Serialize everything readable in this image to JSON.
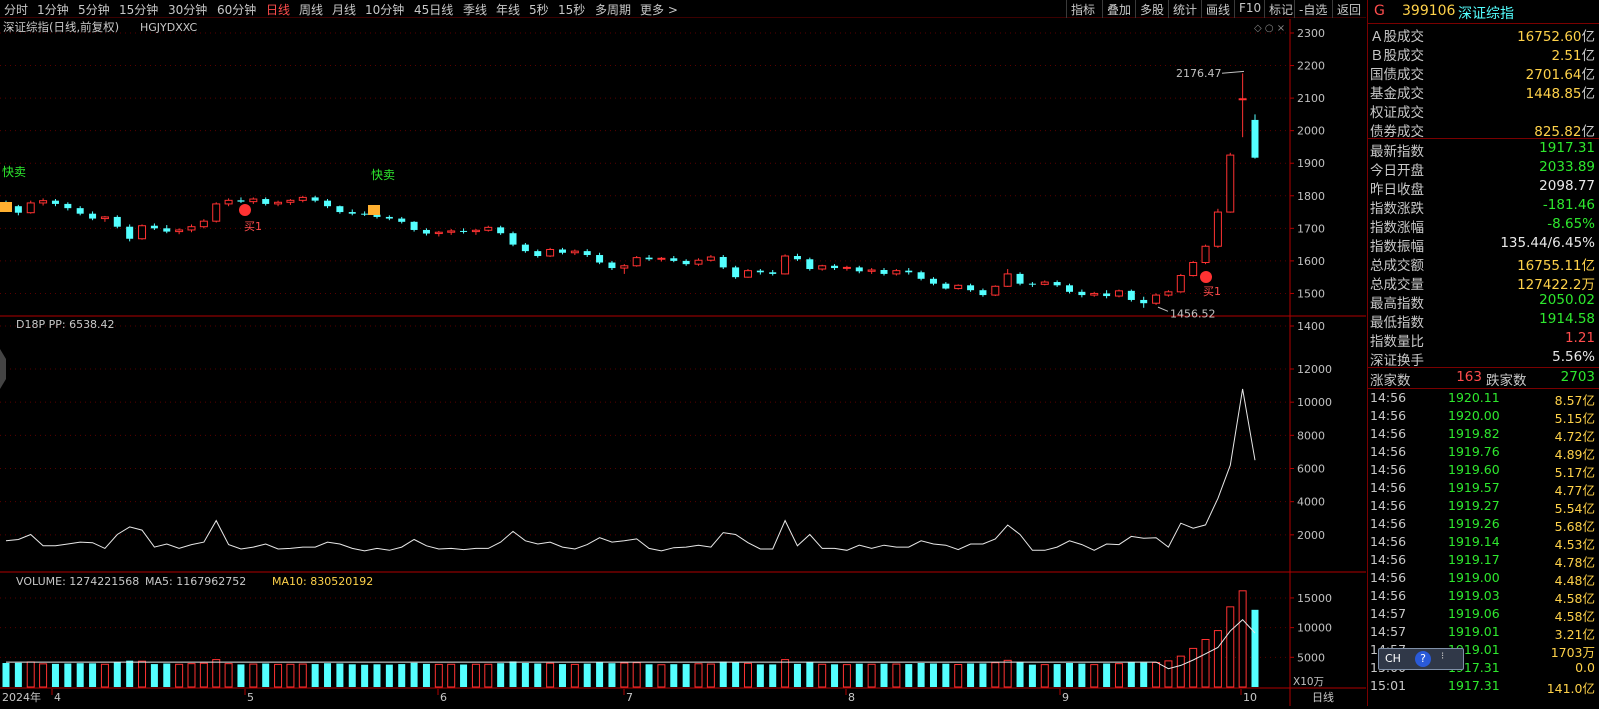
{
  "toolbar": {
    "periods": [
      "分时",
      "1分钟",
      "5分钟",
      "15分钟",
      "30分钟",
      "60分钟",
      "日线",
      "周线",
      "月线",
      "10分钟",
      "45日线",
      "季线",
      "年线",
      "5秒",
      "15秒",
      "多周期",
      "更多 >"
    ],
    "active": "日线",
    "right": [
      "指标",
      "叠加",
      "多股",
      "统计",
      "画线",
      "F10",
      "标记",
      "-自选",
      "返回"
    ]
  },
  "chart": {
    "title": "深证综指(日线,前复权)",
    "indicator_tag": "HGJYDXXC",
    "price_high_label": "2176.47",
    "price_low_label": "1456.52",
    "sell_signal": "快卖",
    "buy_signal": "买1",
    "osc_label": "D18P  PP: 6538.42",
    "vol_label": "VOLUME: 1274221568",
    "ma5_label": "MA5: 1167962752",
    "ma10_label": "MA10: 830520192",
    "vol_unit": "X10万",
    "period_label": "日线",
    "year_label": "2024年",
    "month_labels": [
      "4",
      "5",
      "6",
      "7",
      "8",
      "9",
      "10"
    ],
    "price_ticks": [
      "2300",
      "2200",
      "2100",
      "2000",
      "1900",
      "1800",
      "1700",
      "1600",
      "1500",
      "1400"
    ],
    "osc_ticks": [
      "12000",
      "10000",
      "8000",
      "6000",
      "4000",
      "2000"
    ],
    "vol_ticks": [
      "15000",
      "10000",
      "5000"
    ]
  },
  "chart_data": {
    "type": "candlestick",
    "ylim": [
      1400,
      2300
    ],
    "candles": [
      [
        1778,
        1785,
        1755,
        1768
      ],
      [
        1768,
        1772,
        1740,
        1748
      ],
      [
        1748,
        1785,
        1745,
        1778
      ],
      [
        1778,
        1792,
        1770,
        1785
      ],
      [
        1785,
        1790,
        1768,
        1775
      ],
      [
        1775,
        1780,
        1755,
        1762
      ],
      [
        1762,
        1768,
        1740,
        1745
      ],
      [
        1745,
        1752,
        1725,
        1730
      ],
      [
        1730,
        1738,
        1720,
        1735
      ],
      [
        1735,
        1740,
        1700,
        1705
      ],
      [
        1705,
        1712,
        1660,
        1668
      ],
      [
        1668,
        1712,
        1665,
        1708
      ],
      [
        1708,
        1715,
        1695,
        1700
      ],
      [
        1700,
        1710,
        1685,
        1690
      ],
      [
        1690,
        1700,
        1682,
        1695
      ],
      [
        1695,
        1712,
        1688,
        1705
      ],
      [
        1705,
        1728,
        1700,
        1722
      ],
      [
        1722,
        1780,
        1718,
        1775
      ],
      [
        1775,
        1792,
        1768,
        1786
      ],
      [
        1786,
        1795,
        1778,
        1782
      ],
      [
        1782,
        1795,
        1775,
        1790
      ],
      [
        1790,
        1795,
        1770,
        1775
      ],
      [
        1775,
        1785,
        1768,
        1780
      ],
      [
        1780,
        1790,
        1772,
        1786
      ],
      [
        1786,
        1800,
        1780,
        1795
      ],
      [
        1795,
        1800,
        1780,
        1785
      ],
      [
        1785,
        1790,
        1762,
        1768
      ],
      [
        1768,
        1770,
        1745,
        1750
      ],
      [
        1750,
        1758,
        1740,
        1745
      ],
      [
        1745,
        1752,
        1738,
        1742
      ],
      [
        1742,
        1748,
        1730,
        1735
      ],
      [
        1735,
        1740,
        1725,
        1730
      ],
      [
        1730,
        1735,
        1715,
        1720
      ],
      [
        1720,
        1722,
        1690,
        1695
      ],
      [
        1695,
        1700,
        1678,
        1684
      ],
      [
        1684,
        1692,
        1675,
        1688
      ],
      [
        1688,
        1698,
        1680,
        1692
      ],
      [
        1692,
        1700,
        1684,
        1690
      ],
      [
        1690,
        1698,
        1680,
        1694
      ],
      [
        1694,
        1708,
        1690,
        1703
      ],
      [
        1703,
        1708,
        1680,
        1685
      ],
      [
        1685,
        1690,
        1645,
        1650
      ],
      [
        1650,
        1655,
        1625,
        1630
      ],
      [
        1630,
        1635,
        1610,
        1615
      ],
      [
        1615,
        1640,
        1612,
        1635
      ],
      [
        1635,
        1640,
        1620,
        1625
      ],
      [
        1625,
        1635,
        1618,
        1630
      ],
      [
        1630,
        1636,
        1612,
        1618
      ],
      [
        1618,
        1625,
        1590,
        1595
      ],
      [
        1595,
        1600,
        1572,
        1578
      ],
      [
        1578,
        1590,
        1560,
        1585
      ],
      [
        1585,
        1615,
        1582,
        1610
      ],
      [
        1610,
        1618,
        1600,
        1605
      ],
      [
        1605,
        1612,
        1598,
        1608
      ],
      [
        1608,
        1615,
        1596,
        1600
      ],
      [
        1600,
        1605,
        1585,
        1590
      ],
      [
        1590,
        1608,
        1585,
        1602
      ],
      [
        1602,
        1618,
        1598,
        1612
      ],
      [
        1612,
        1618,
        1575,
        1580
      ],
      [
        1580,
        1585,
        1545,
        1550
      ],
      [
        1550,
        1575,
        1548,
        1570
      ],
      [
        1570,
        1575,
        1558,
        1565
      ],
      [
        1565,
        1572,
        1555,
        1560
      ],
      [
        1560,
        1620,
        1558,
        1615
      ],
      [
        1615,
        1622,
        1600,
        1605
      ],
      [
        1605,
        1610,
        1570,
        1575
      ],
      [
        1575,
        1588,
        1570,
        1585
      ],
      [
        1585,
        1590,
        1572,
        1578
      ],
      [
        1578,
        1585,
        1570,
        1580
      ],
      [
        1580,
        1585,
        1562,
        1568
      ],
      [
        1568,
        1578,
        1560,
        1572
      ],
      [
        1572,
        1578,
        1555,
        1560
      ],
      [
        1560,
        1575,
        1555,
        1570
      ],
      [
        1570,
        1578,
        1558,
        1565
      ],
      [
        1565,
        1570,
        1540,
        1545
      ],
      [
        1545,
        1550,
        1525,
        1530
      ],
      [
        1530,
        1535,
        1512,
        1515
      ],
      [
        1515,
        1528,
        1512,
        1525
      ],
      [
        1525,
        1530,
        1505,
        1510
      ],
      [
        1510,
        1515,
        1490,
        1495
      ],
      [
        1495,
        1525,
        1492,
        1522
      ],
      [
        1522,
        1575,
        1520,
        1560
      ],
      [
        1560,
        1565,
        1525,
        1530
      ],
      [
        1530,
        1535,
        1520,
        1528
      ],
      [
        1528,
        1540,
        1525,
        1535
      ],
      [
        1535,
        1540,
        1520,
        1525
      ],
      [
        1525,
        1530,
        1500,
        1505
      ],
      [
        1505,
        1512,
        1488,
        1495
      ],
      [
        1495,
        1505,
        1490,
        1500
      ],
      [
        1500,
        1510,
        1485,
        1492
      ],
      [
        1492,
        1512,
        1488,
        1508
      ],
      [
        1508,
        1512,
        1475,
        1480
      ],
      [
        1480,
        1490,
        1456,
        1470
      ],
      [
        1470,
        1500,
        1465,
        1495
      ],
      [
        1495,
        1510,
        1490,
        1505
      ],
      [
        1505,
        1560,
        1502,
        1555
      ],
      [
        1555,
        1600,
        1552,
        1595
      ],
      [
        1595,
        1650,
        1590,
        1645
      ],
      [
        1645,
        1760,
        1640,
        1750
      ],
      [
        1750,
        1932,
        1748,
        1925
      ],
      [
        2095,
        2176,
        1980,
        2098
      ],
      [
        2033,
        2050,
        1914,
        1917
      ]
    ],
    "volume_ticks": [
      15000,
      10000,
      5000
    ],
    "oscillator_ticks": [
      12000,
      10000,
      8000,
      6000,
      4000,
      2000
    ]
  },
  "quote": {
    "code": "399106",
    "name": "深证综指",
    "g": "G",
    "rows1": [
      {
        "label": "Ａ股成交",
        "value": "16752.60",
        "unit": "亿"
      },
      {
        "label": "Ｂ股成交",
        "value": "2.51",
        "unit": "亿"
      },
      {
        "label": "国债成交",
        "value": "2701.64",
        "unit": "亿"
      },
      {
        "label": "基金成交",
        "value": "1448.85",
        "unit": "亿"
      },
      {
        "label": "权证成交",
        "value": "",
        "unit": ""
      },
      {
        "label": "债券成交",
        "value": "825.82",
        "unit": "亿"
      }
    ],
    "rows2": [
      {
        "label": "最新指数",
        "value": "1917.31",
        "color": "#2ee82e"
      },
      {
        "label": "今日开盘",
        "value": "2033.89",
        "color": "#2ee82e"
      },
      {
        "label": "昨日收盘",
        "value": "2098.77",
        "color": "#e8e8e8"
      },
      {
        "label": "指数涨跌",
        "value": "-181.46",
        "color": "#2ee82e"
      },
      {
        "label": "指数涨幅",
        "value": "-8.65%",
        "color": "#2ee82e"
      },
      {
        "label": "指数振幅",
        "value": "135.44/6.45%",
        "color": "#e8e8e8"
      },
      {
        "label": "总成交额",
        "value": "16755.11亿",
        "color": "#ffd24a"
      },
      {
        "label": "总成交量",
        "value": "127422.2万",
        "color": "#ffd24a"
      },
      {
        "label": "最高指数",
        "value": "2050.02",
        "color": "#2ee82e"
      },
      {
        "label": "最低指数",
        "value": "1914.58",
        "color": "#2ee82e"
      },
      {
        "label": "指数量比",
        "value": "1.21",
        "color": "#ff4d4d"
      },
      {
        "label": "深证换手",
        "value": "5.56%",
        "color": "#e8e8e8"
      }
    ],
    "up_label": "涨家数",
    "up_count": "163",
    "down_label": "跌家数",
    "down_count": "2703",
    "ticks": [
      {
        "time": "14:56",
        "price": "1920.11",
        "vol": "8.57亿"
      },
      {
        "time": "14:56",
        "price": "1920.00",
        "vol": "5.15亿"
      },
      {
        "time": "14:56",
        "price": "1919.82",
        "vol": "4.72亿"
      },
      {
        "time": "14:56",
        "price": "1919.76",
        "vol": "4.89亿"
      },
      {
        "time": "14:56",
        "price": "1919.60",
        "vol": "5.17亿"
      },
      {
        "time": "14:56",
        "price": "1919.57",
        "vol": "4.77亿"
      },
      {
        "time": "14:56",
        "price": "1919.27",
        "vol": "5.54亿"
      },
      {
        "time": "14:56",
        "price": "1919.26",
        "vol": "5.68亿"
      },
      {
        "time": "14:56",
        "price": "1919.14",
        "vol": "4.53亿"
      },
      {
        "time": "14:56",
        "price": "1919.17",
        "vol": "4.78亿"
      },
      {
        "time": "14:56",
        "price": "1919.00",
        "vol": "4.48亿"
      },
      {
        "time": "14:56",
        "price": "1919.03",
        "vol": "4.58亿"
      },
      {
        "time": "14:57",
        "price": "1919.06",
        "vol": "4.58亿"
      },
      {
        "time": "14:57",
        "price": "1919.01",
        "vol": "3.21亿"
      },
      {
        "time": "14:57",
        "price": "1919.01",
        "vol": "1703万"
      },
      {
        "time": "15:00",
        "price": "1917.31",
        "vol": "0.0"
      },
      {
        "time": "15:01",
        "price": "1917.31",
        "vol": "141.0亿"
      }
    ],
    "ime_label": "CH"
  },
  "colors": {
    "up": "#ff3232",
    "down": "#54ffff",
    "grid": "#7a0000",
    "text": "#c8c8c8"
  }
}
